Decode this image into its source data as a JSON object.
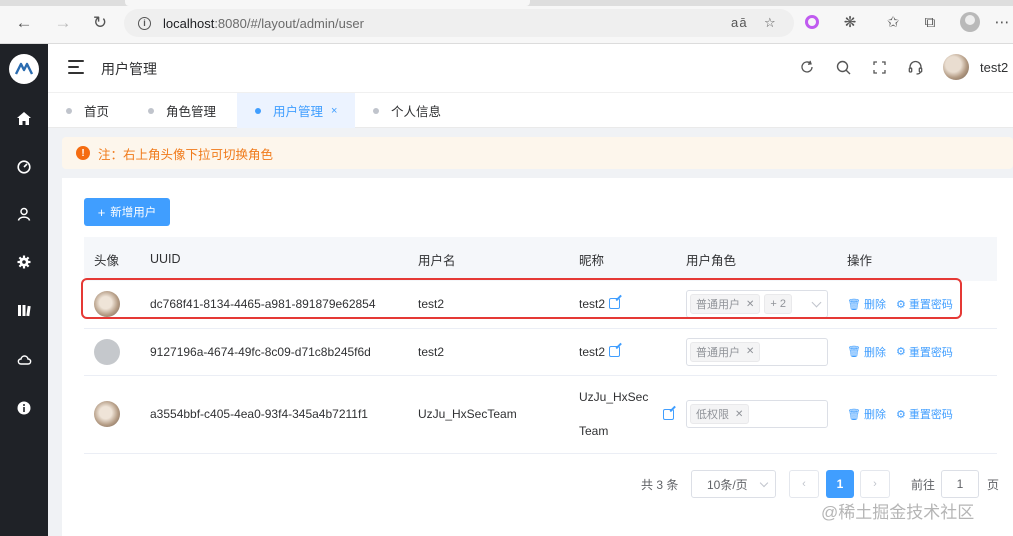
{
  "browser": {
    "url_host": "localhost",
    "url_path": ":8080/#/layout/admin/user"
  },
  "header": {
    "title": "用户管理",
    "username": "test2"
  },
  "page_tabs": [
    {
      "label": "首页"
    },
    {
      "label": "角色管理"
    },
    {
      "label": "用户管理",
      "close": "×"
    },
    {
      "label": "个人信息"
    }
  ],
  "notice": {
    "icon": "!",
    "text": "注：右上角头像下拉可切换角色"
  },
  "toolbar": {
    "add_label": "新增用户"
  },
  "table": {
    "columns": [
      "头像",
      "UUID",
      "用户名",
      "昵称",
      "用户角色",
      "操作"
    ],
    "rows": [
      {
        "uuid": "dc768f41-8134-4465-a981-891879e62854",
        "username": "test2",
        "nickname": "test2",
        "roles": [
          "普通用户"
        ],
        "more": "+ 2"
      },
      {
        "uuid": "9127196a-4674-49fc-8c09-d71c8b245f6d",
        "username": "test2",
        "nickname": "test2",
        "roles": [
          "普通用户"
        ],
        "more": ""
      },
      {
        "uuid": "a3554bbf-c405-4ea0-93f4-345a4b7211f1",
        "username": "UzJu_HxSecTeam",
        "nickname_line1": "UzJu_HxSec",
        "nickname_line2": "Team",
        "roles": [
          "低权限"
        ],
        "more": ""
      }
    ],
    "actions": {
      "delete": "删除",
      "reset": "重置密码"
    }
  },
  "pagination": {
    "total": "共 3 条",
    "page_size": "10条/页",
    "current_page": "1",
    "goto_label": "前往",
    "goto_value": "1",
    "goto_unit": "页"
  },
  "watermark": "@稀土掘金技术社区",
  "colors": {
    "primary": "#409eff",
    "sidebar": "#1f2227",
    "warning": "#f07a1a",
    "highlight": "#e53935"
  }
}
